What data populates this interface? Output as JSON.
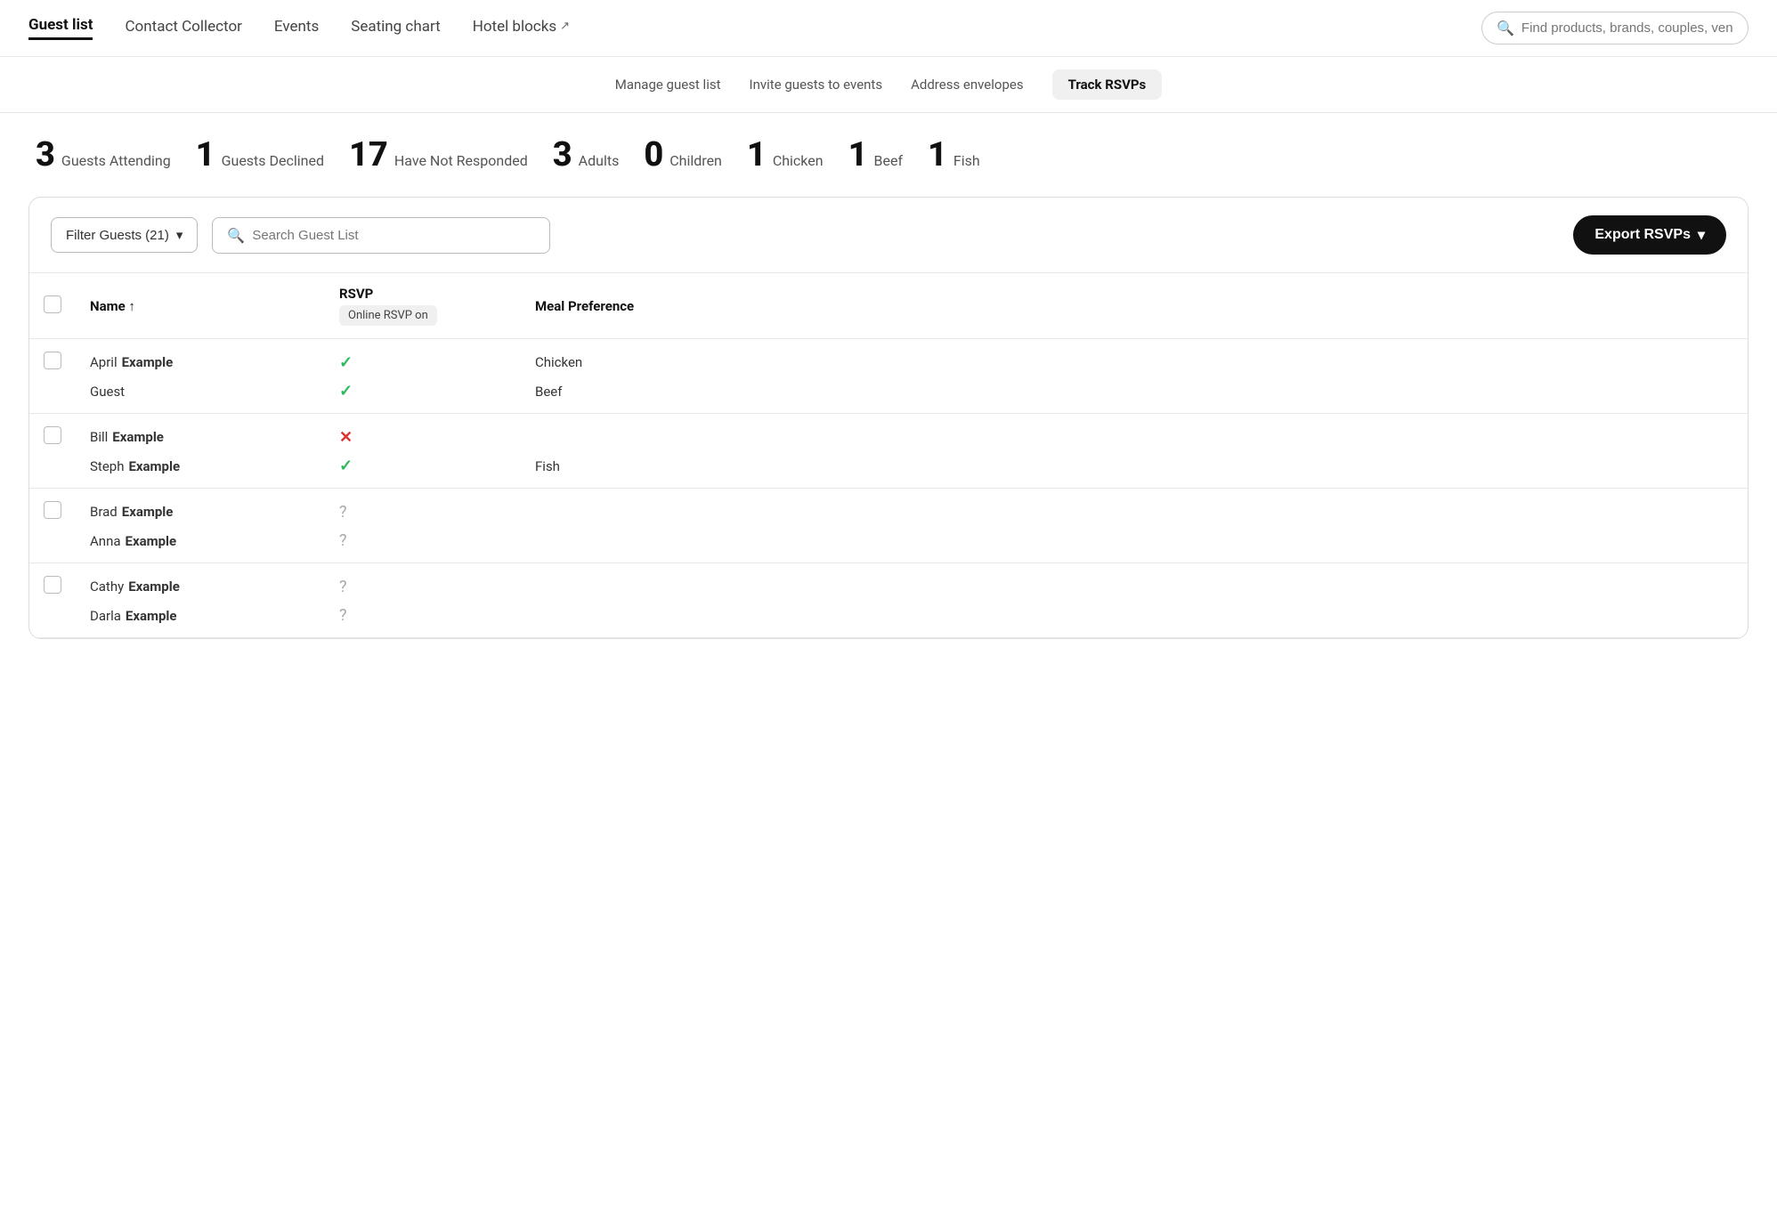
{
  "nav": {
    "items": [
      {
        "id": "guest-list",
        "label": "Guest list",
        "active": true,
        "external": false
      },
      {
        "id": "contact-collector",
        "label": "Contact Collector",
        "active": false,
        "external": false
      },
      {
        "id": "events",
        "label": "Events",
        "active": false,
        "external": false
      },
      {
        "id": "seating-chart",
        "label": "Seating chart",
        "active": false,
        "external": false
      },
      {
        "id": "hotel-blocks",
        "label": "Hotel blocks",
        "active": false,
        "external": true
      }
    ],
    "search_placeholder": "Find products, brands, couples, vend..."
  },
  "sub_nav": {
    "items": [
      {
        "id": "manage-guest-list",
        "label": "Manage guest list",
        "active": false
      },
      {
        "id": "invite-guests",
        "label": "Invite guests to events",
        "active": false
      },
      {
        "id": "address-envelopes",
        "label": "Address envelopes",
        "active": false
      },
      {
        "id": "track-rsvps",
        "label": "Track RSVPs",
        "active": true
      }
    ]
  },
  "stats": [
    {
      "id": "attending",
      "number": "3",
      "label": "Guests Attending"
    },
    {
      "id": "declined",
      "number": "1",
      "label": "Guests Declined"
    },
    {
      "id": "not-responded",
      "number": "17",
      "label": "Have Not Responded"
    },
    {
      "id": "adults",
      "number": "3",
      "label": "Adults"
    },
    {
      "id": "children",
      "number": "0",
      "label": "Children"
    },
    {
      "id": "chicken",
      "number": "1",
      "label": "Chicken"
    },
    {
      "id": "beef",
      "number": "1",
      "label": "Beef"
    },
    {
      "id": "fish",
      "number": "1",
      "label": "Fish"
    }
  ],
  "toolbar": {
    "filter_label": "Filter Guests (21)",
    "search_placeholder": "Search Guest List",
    "export_label": "Export RSVPs"
  },
  "table": {
    "columns": {
      "name": "Name ↑",
      "rsvp": "RSVP",
      "rsvp_sub": "Online RSVP on",
      "meal": "Meal Preference"
    },
    "rows": [
      {
        "id": "april-example",
        "guests": [
          {
            "first": "April",
            "last": "Example",
            "role": "",
            "rsvp": "yes",
            "meal": "Chicken"
          },
          {
            "first": "Guest",
            "last": "",
            "role": "",
            "rsvp": "yes",
            "meal": "Beef"
          }
        ]
      },
      {
        "id": "bill-example",
        "guests": [
          {
            "first": "Bill",
            "last": "Example",
            "role": "",
            "rsvp": "no",
            "meal": ""
          },
          {
            "first": "Steph Example",
            "last": "",
            "role": "",
            "rsvp": "yes",
            "meal": "Fish"
          }
        ]
      },
      {
        "id": "brad-example",
        "guests": [
          {
            "first": "Brad",
            "last": "Example",
            "role": "",
            "rsvp": "unknown",
            "meal": ""
          },
          {
            "first": "Anna Example",
            "last": "",
            "role": "",
            "rsvp": "unknown",
            "meal": ""
          }
        ]
      },
      {
        "id": "cathy-example",
        "guests": [
          {
            "first": "Cathy",
            "last": "Example",
            "role": "",
            "rsvp": "unknown",
            "meal": ""
          },
          {
            "first": "Darla Example",
            "last": "",
            "role": "",
            "rsvp": "unknown",
            "meal": ""
          }
        ]
      }
    ]
  }
}
